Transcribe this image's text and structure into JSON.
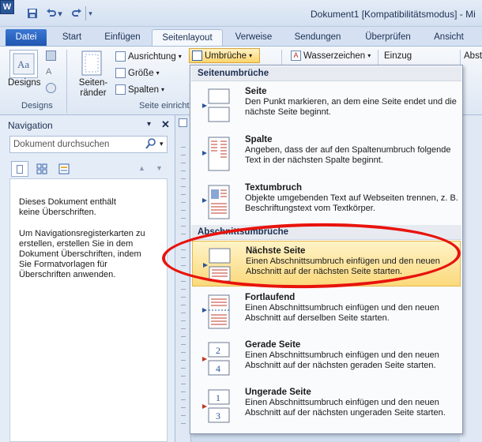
{
  "app_icon": "W",
  "window_title": "Dokument1 [Kompatibilitätsmodus] - Mi",
  "tabs": [
    "Datei",
    "Start",
    "Einfügen",
    "Seitenlayout",
    "Verweise",
    "Sendungen",
    "Überprüfen",
    "Ansicht"
  ],
  "ribbon": {
    "designs_label": "Designs",
    "designs_group": "Designs",
    "seitenraender": "Seiten-\nränder",
    "ausrichtung": "Ausrichtung",
    "groesse": "Größe",
    "spalten": "Spalten",
    "umbrueche": "Umbrüche",
    "wasserzeichen": "Wasserzeichen",
    "einzug": "Einzug",
    "abst": "Abst",
    "seite_einrichten_group": "Seite einricht"
  },
  "nav": {
    "title": "Navigation",
    "search_placeholder": "Dokument durchsuchen",
    "message1": "Dieses Dokument enthält keine Überschriften.",
    "message2": "Um Navigationsregisterkarten zu erstellen, erstellen Sie in dem Dokument Überschriften, indem Sie Formatvorlagen für Überschriften anwenden."
  },
  "menu": {
    "header1": "Seitenumbrüche",
    "header2": "Abschnittsumbrüche",
    "items": [
      {
        "title": "Seite",
        "desc": "Den Punkt markieren, an dem eine Seite endet und die nächste Seite beginnt."
      },
      {
        "title": "Spalte",
        "desc": "Angeben, dass der auf den Spaltenumbruch folgende Text in der nächsten Spalte beginnt."
      },
      {
        "title": "Textumbruch",
        "desc": "Objekte umgebenden Text auf Webseiten trennen, z. B. Beschriftungstext vom Textkörper."
      },
      {
        "title": "Nächste Seite",
        "desc": "Einen Abschnittsumbruch einfügen und den neuen Abschnitt auf der nächsten Seite starten."
      },
      {
        "title": "Fortlaufend",
        "desc": "Einen Abschnittsumbruch einfügen und den neuen Abschnitt auf derselben Seite starten."
      },
      {
        "title": "Gerade Seite",
        "desc": "Einen Abschnittsumbruch einfügen und den neuen Abschnitt auf der nächsten geraden Seite starten."
      },
      {
        "title": "Ungerade Seite",
        "desc": "Einen Abschnittsumbruch einfügen und den neuen Abschnitt auf der nächsten ungeraden Seite starten."
      }
    ],
    "icon_labels": {
      "even_top": "2",
      "even_bottom": "4",
      "odd_top": "1",
      "odd_bottom": "3"
    }
  },
  "colors": {
    "highlight": "#fbd97c",
    "annotation": "#e8130c",
    "accent": "#1f56b0"
  }
}
